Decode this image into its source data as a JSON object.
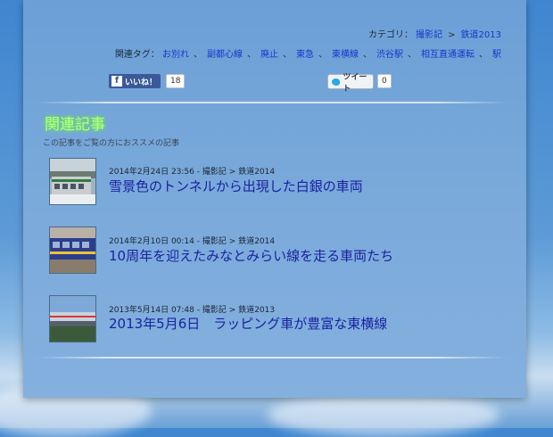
{
  "breadcrumb": {
    "label": "カテゴリ：",
    "parent": "撮影記",
    "sep": ">",
    "current": "鉄道2013"
  },
  "tags": {
    "label": "関連タグ：",
    "items": [
      "お別れ",
      "副都心線",
      "廃止",
      "東急",
      "東横線",
      "渋谷駅",
      "相互直通運転",
      "駅"
    ]
  },
  "social": {
    "facebook_label": "いいね！",
    "facebook_icon": "f",
    "facebook_count": "18",
    "tweet_label": "ツイート",
    "tweet_count": "0"
  },
  "related": {
    "title": "関連記事",
    "subtitle": "この記事をご覧の方におススメの記事"
  },
  "articles": [
    {
      "date": "2014年2月24日 23:56",
      "dash": "-",
      "category": "撮影記",
      "sep": ">",
      "subcategory": "鉄道2014",
      "title": "雪景色のトンネルから出現した白銀の車両"
    },
    {
      "date": "2014年2月10日 00:14",
      "dash": "-",
      "category": "撮影記",
      "sep": ">",
      "subcategory": "鉄道2014",
      "title": "10周年を迎えたみなとみらい線を走る車両たち"
    },
    {
      "date": "2013年5月14日 07:48",
      "dash": "-",
      "category": "撮影記",
      "sep": ">",
      "subcategory": "鉄道2013",
      "title": "2013年5月6日　ラッピング車が豊富な東横線"
    }
  ]
}
